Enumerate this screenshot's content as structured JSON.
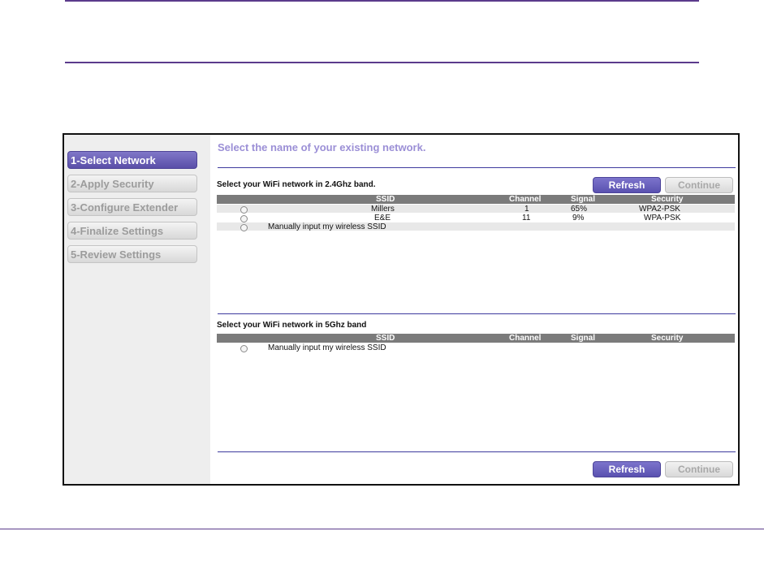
{
  "sidebar": {
    "steps": [
      {
        "label": "1-Select Network",
        "active": true
      },
      {
        "label": "2-Apply Security",
        "active": false
      },
      {
        "label": "3-Configure Extender",
        "active": false
      },
      {
        "label": "4-Finalize Settings",
        "active": false
      },
      {
        "label": "5-Review Settings",
        "active": false
      }
    ]
  },
  "main": {
    "heading": "Select the name of your existing network.",
    "band24": {
      "label": "Select your WiFi network in 2.4Ghz band.",
      "columns": {
        "ssid": "SSID",
        "channel": "Channel",
        "signal": "Signal",
        "security": "Security"
      },
      "rows": [
        {
          "ssid": "Millers",
          "channel": "1",
          "signal": "65%",
          "security": "WPA2-PSK"
        },
        {
          "ssid": "E&E",
          "channel": "11",
          "signal": "9%",
          "security": "WPA-PSK"
        }
      ],
      "manual": "Manually input my wireless SSID"
    },
    "band5": {
      "label": "Select your WiFi network in 5Ghz band",
      "columns": {
        "ssid": "SSID",
        "channel": "Channel",
        "signal": "Signal",
        "security": "Security"
      },
      "manual": "Manually input my wireless SSID"
    },
    "buttons": {
      "refresh": "Refresh",
      "continue": "Continue"
    }
  },
  "colors": {
    "accent": "#5a51b0",
    "heading": "#9b8fd6",
    "rule": "#5b3b8c",
    "table_header": "#7b7b7b"
  }
}
